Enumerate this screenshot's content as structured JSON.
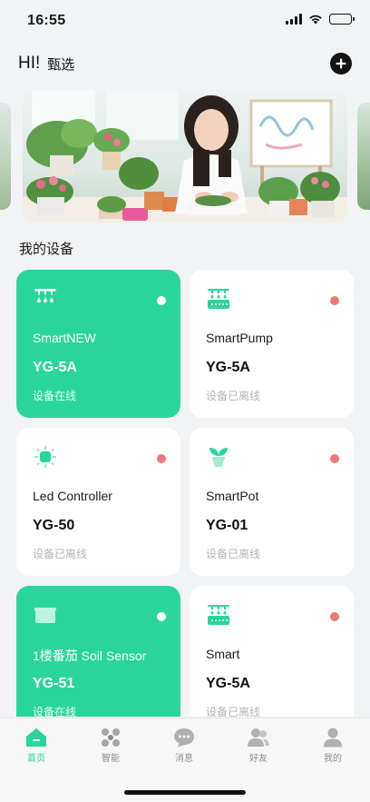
{
  "status_bar": {
    "time": "16:55",
    "icons": [
      "cellular-signal-icon",
      "wifi-icon",
      "battery-icon"
    ]
  },
  "header": {
    "greeting": "HI!",
    "title": "甄选",
    "add_icon": "plus-circle-icon"
  },
  "banner": {
    "image": "woman-planting-flowers-photo"
  },
  "section": {
    "title": "我的设备"
  },
  "colors": {
    "accent": "#2ad59b",
    "offline_dot": "#ee7a75",
    "background": "#f2f3f5"
  },
  "devices": [
    {
      "name": "SmartNEW",
      "model": "YG-5A",
      "status": "设备在线",
      "online": true,
      "icon": "sprinkler-icon"
    },
    {
      "name": "SmartPump",
      "model": "YG-5A",
      "status": "设备已离线",
      "online": false,
      "icon": "water-pump-icon"
    },
    {
      "name": "Led Controller",
      "model": "YG-50",
      "status": "设备已离线",
      "online": false,
      "icon": "led-light-icon"
    },
    {
      "name": "SmartPot",
      "model": "YG-01",
      "status": "设备已离线",
      "online": false,
      "icon": "plant-pot-icon"
    },
    {
      "name": "1楼番茄 Soil Sensor",
      "model": "YG-51",
      "status": "设备在线",
      "online": true,
      "icon": "soil-sensor-icon"
    },
    {
      "name": "Smart",
      "model": "YG-5A",
      "status": "设备已离线",
      "online": false,
      "icon": "water-pump-icon"
    }
  ],
  "tabbar": {
    "tabs": [
      {
        "label": "首页",
        "icon": "home-icon",
        "active": true
      },
      {
        "label": "智能",
        "icon": "smart-grid-icon",
        "active": false
      },
      {
        "label": "消息",
        "icon": "message-icon",
        "active": false
      },
      {
        "label": "好友",
        "icon": "friends-icon",
        "active": false
      },
      {
        "label": "我的",
        "icon": "profile-icon",
        "active": false
      }
    ]
  }
}
